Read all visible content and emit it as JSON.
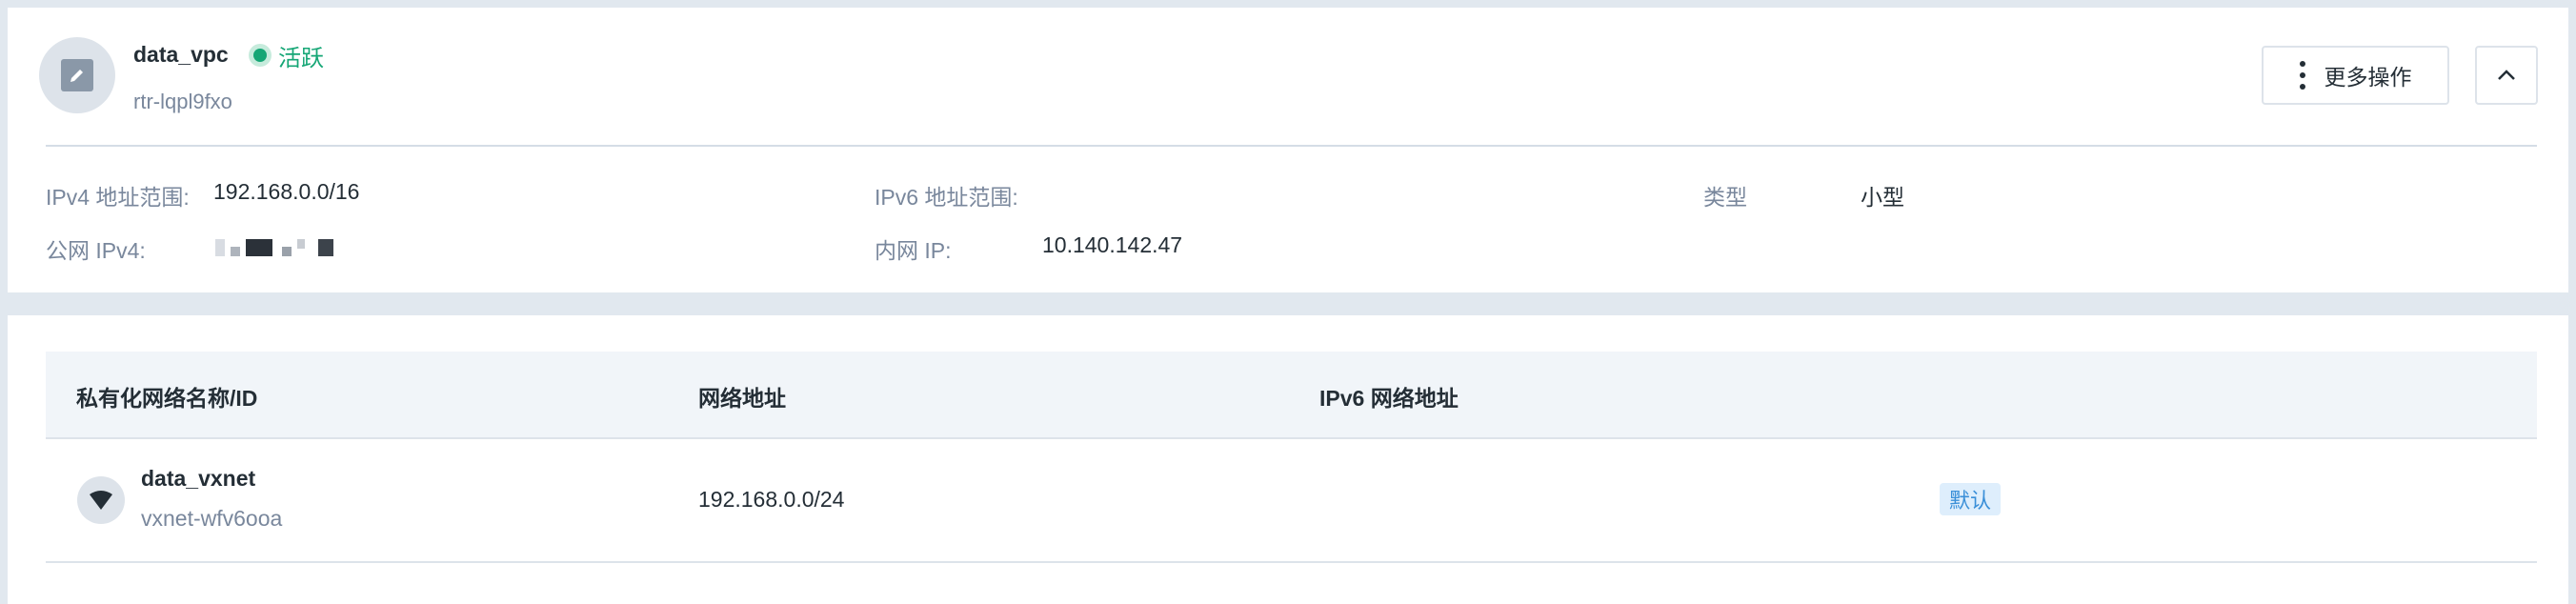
{
  "router": {
    "name": "data_vpc",
    "status": "活跃",
    "id": "rtr-lqpl9fxo",
    "more_label": "更多操作",
    "icons": {
      "avatar": "edit-icon",
      "more": "kebab-icon",
      "collapse": "chevron-up-icon"
    }
  },
  "details": {
    "ipv4_label": "IPv4 地址范围:",
    "ipv4_value": "192.168.0.0/16",
    "ipv6_label": "IPv6 地址范围:",
    "ipv6_value": "",
    "type_label": "类型",
    "type_value": "小型",
    "public_ipv4_label": "公网 IPv4:",
    "private_ip_label": "内网 IP:",
    "private_ip_value": "10.140.142.47"
  },
  "table": {
    "columns": [
      "私有化网络名称/ID",
      "网络地址",
      "IPv6 网络地址"
    ],
    "rows": [
      {
        "name": "data_vxnet",
        "id": "vxnet-wfv6ooa",
        "address": "192.168.0.0/24",
        "ipv6": "",
        "badge": "默认"
      }
    ]
  },
  "colors": {
    "status_green": "#15a675",
    "badge_blue": "#3a8fd8",
    "page_bg": "#e1e8ef"
  }
}
